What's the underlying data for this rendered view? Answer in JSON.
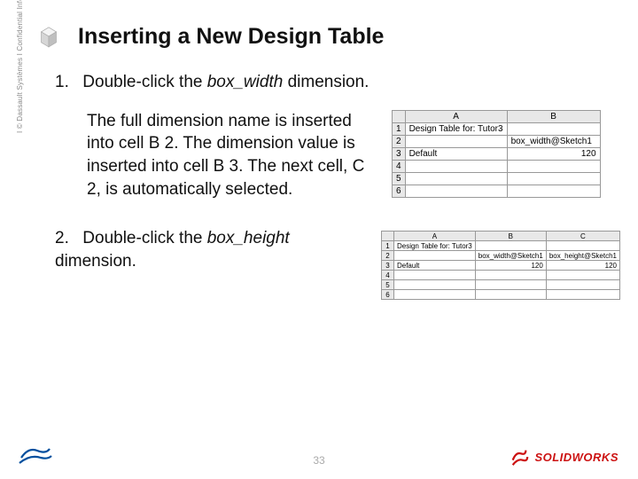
{
  "title": "Inserting a New Design Table",
  "steps": [
    {
      "num": "1.",
      "text_before": "Double-click the ",
      "em": "box_width",
      "text_after": " dimension."
    },
    {
      "num": "2.",
      "text_before": "Double-click the ",
      "em": "box_height",
      "text_after": " dimension."
    }
  ],
  "explanation": "The full dimension name is inserted into cell B 2. The dimension value is inserted into cell B 3.\nThe next cell, C 2, is automatically selected.",
  "sidebar": "Ι © Dassault Systèmes Ι Confidential Information Ι",
  "page_number": "33",
  "sw_brand": "SOLIDWORKS",
  "sheet1": {
    "cols": [
      "A",
      "B"
    ],
    "rows": [
      {
        "n": "1",
        "cells": [
          "Design Table for: Tutor3",
          ""
        ]
      },
      {
        "n": "2",
        "cells": [
          "",
          "box_width@Sketch1"
        ]
      },
      {
        "n": "3",
        "cells": [
          "Default",
          "120"
        ]
      },
      {
        "n": "4",
        "cells": [
          "",
          ""
        ]
      },
      {
        "n": "5",
        "cells": [
          "",
          ""
        ]
      },
      {
        "n": "6",
        "cells": [
          "",
          ""
        ]
      }
    ]
  },
  "sheet2": {
    "cols": [
      "A",
      "B",
      "C"
    ],
    "rows": [
      {
        "n": "1",
        "cells": [
          "Design Table for: Tutor3",
          "",
          ""
        ]
      },
      {
        "n": "2",
        "cells": [
          "",
          "box_width@Sketch1",
          "box_height@Sketch1"
        ]
      },
      {
        "n": "3",
        "cells": [
          "Default",
          "120",
          "120"
        ]
      },
      {
        "n": "4",
        "cells": [
          "",
          "",
          ""
        ]
      },
      {
        "n": "5",
        "cells": [
          "",
          "",
          ""
        ]
      },
      {
        "n": "6",
        "cells": [
          "",
          "",
          ""
        ]
      }
    ]
  }
}
